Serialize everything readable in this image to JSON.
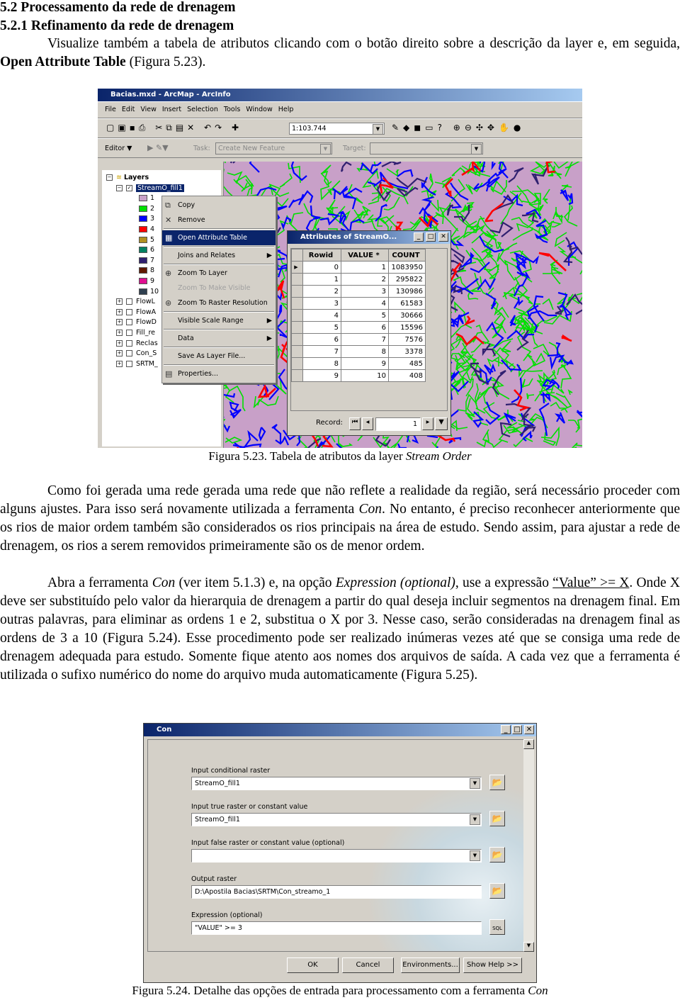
{
  "headings": {
    "h1": "5.2 Processamento da rede de drenagem",
    "h2": "5.2.1 Refinamento da rede de drenagem"
  },
  "intro": {
    "t1": "Visualize também a tabela de atributos clicando com o botão direito sobre a descrição da layer e, em seguida, ",
    "bold": "Open Attribute Table",
    "t2": " (Figura 5.23)."
  },
  "fig1": {
    "caption_prefix": "Figura 5.23. Tabela de atributos da layer ",
    "caption_italic": "Stream Order",
    "window_title": "Bacias.mxd - ArcMap - ArcInfo",
    "menu": [
      "File",
      "Edit",
      "View",
      "Insert",
      "Selection",
      "Tools",
      "Window",
      "Help"
    ],
    "scale": "1:103.744",
    "editor": {
      "label": "Editor",
      "task_label": "Task:",
      "task_value": "Create New Feature",
      "target_label": "Target:"
    },
    "toc": {
      "root": "Layers",
      "layer": "StreamO_fill1",
      "classes": [
        {
          "v": "1",
          "c": "#c8a0c8"
        },
        {
          "v": "2",
          "c": "#00e000"
        },
        {
          "v": "3",
          "c": "#0000ff"
        },
        {
          "v": "4",
          "c": "#ff0000"
        },
        {
          "v": "5",
          "c": "#b09020"
        },
        {
          "v": "6",
          "c": "#008060"
        },
        {
          "v": "7",
          "c": "#302070"
        },
        {
          "v": "8",
          "c": "#601800"
        },
        {
          "v": "9",
          "c": "#e01090"
        },
        {
          "v": "10",
          "c": "#304050"
        }
      ],
      "other_layers": [
        "FlowL",
        "FlowA",
        "FlowD",
        "Fill_re",
        "Reclas",
        "Con_S",
        "SRTM_"
      ]
    },
    "context_menu": [
      {
        "label": "Copy",
        "icon": "copy-icon"
      },
      {
        "label": "Remove",
        "icon": "remove-icon"
      },
      {
        "label": "Open Attribute Table",
        "icon": "table-icon",
        "selected": true
      },
      {
        "label": "Joins and Relates",
        "submenu": true
      },
      {
        "label": "Zoom To Layer",
        "icon": "zoom-layer-icon"
      },
      {
        "label": "Zoom To Make Visible",
        "disabled": true
      },
      {
        "label": "Zoom To Raster Resolution",
        "icon": "zoom-raster-icon"
      },
      {
        "label": "Visible Scale Range",
        "submenu": true
      },
      {
        "label": "Data",
        "submenu": true
      },
      {
        "label": "Save As Layer File..."
      },
      {
        "label": "Properties...",
        "icon": "properties-icon"
      }
    ],
    "attributes": {
      "title": "Attributes of StreamO...",
      "columns": [
        "Rowid",
        "VALUE *",
        "COUNT"
      ],
      "rows": [
        [
          "0",
          "1",
          "1083950"
        ],
        [
          "1",
          "2",
          "295822"
        ],
        [
          "2",
          "3",
          "130986"
        ],
        [
          "3",
          "4",
          "61583"
        ],
        [
          "4",
          "5",
          "30666"
        ],
        [
          "5",
          "6",
          "15596"
        ],
        [
          "6",
          "7",
          "7576"
        ],
        [
          "7",
          "8",
          "3378"
        ],
        [
          "8",
          "9",
          "485"
        ],
        [
          "9",
          "10",
          "408"
        ]
      ],
      "record_label": "Record:",
      "record_value": "1"
    },
    "map_colors": {
      "background": "#c8a0c8",
      "streams": [
        "#00e000",
        "#0000ff",
        "#ff0000",
        "#302070"
      ]
    }
  },
  "para2": {
    "t1": "Como foi gerada uma rede gerada uma rede que não reflete a realidade da região, será necessário proceder com alguns ajustes. Para isso será novamente utilizada a ferramenta ",
    "i1": "Con",
    "t2": ". No entanto, é preciso reconhecer anteriormente que os rios de maior ordem também são considerados os rios principais na área de estudo. Sendo assim, para ajustar a rede de drenagem, os rios a serem removidos primeiramente são os de menor ordem."
  },
  "para3": {
    "t1": "Abra a ferramenta ",
    "i1": "Con",
    "t2": " (ver item 5.1.3) e, na opção ",
    "i2": "Expression (optional)",
    "t3": ", use a expressão ",
    "u1": "“Value” >= X",
    "t4": ". Onde X deve ser substituído pelo valor da hierarquia de drenagem a partir do qual deseja incluir segmentos na drenagem final. Em outras palavras, para eliminar as ordens 1 e 2, substitua o X por 3. Nesse caso, serão consideradas na drenagem final as ordens de 3 a 10 (Figura 5.24).  Esse procedimento pode ser realizado inúmeras vezes até que se consiga uma rede de drenagem adequada para estudo. Somente fique atento aos nomes dos arquivos de saída. A cada vez que a ferramenta é utilizada o sufixo numérico do nome do arquivo muda automaticamente (Figura 5.25)."
  },
  "fig2": {
    "caption_prefix": "Figura 5.24. Detalhe das opções de entrada para processamento com a ferramenta ",
    "caption_italic": "Con",
    "title": "Con",
    "fields": [
      {
        "label": "Input conditional raster",
        "value": "StreamO_fill1",
        "dropdown": true
      },
      {
        "label": "Input true raster or constant value",
        "value": "StreamO_fill1",
        "dropdown": true
      },
      {
        "label": "Input false raster or constant value (optional)",
        "value": "",
        "dropdown": true
      },
      {
        "label": "Output raster",
        "value": "D:\\Apostila Bacias\\SRTM\\Con_streamo_1",
        "dropdown": false
      },
      {
        "label": "Expression (optional)",
        "value": "\"VALUE\" >= 3",
        "dropdown": false
      }
    ],
    "buttons": [
      "OK",
      "Cancel",
      "Environments...",
      "Show Help >>"
    ],
    "sql_label": "SQL"
  }
}
